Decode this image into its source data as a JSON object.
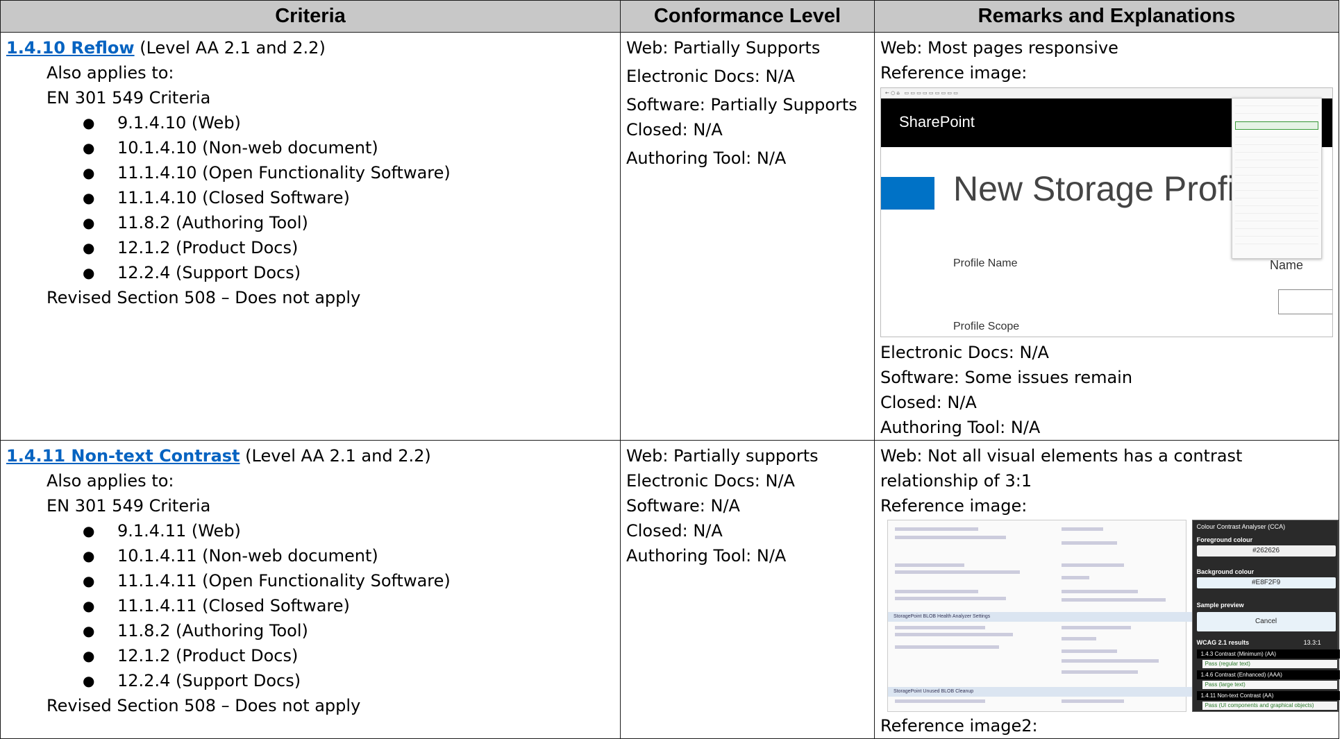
{
  "table": {
    "headers": [
      "Criteria",
      "Conformance Level",
      "Remarks and Explanations"
    ],
    "rows": [
      {
        "criterion_link": "1.4.10 Reflow",
        "criterion_level": " (Level AA 2.1 and 2.2)",
        "also_applies": "Also applies to:",
        "en_label": "EN 301 549 Criteria",
        "en_items": [
          "9.1.4.10 (Web)",
          "10.1.4.10 (Non-web document)",
          "11.1.4.10 (Open Functionality Software)",
          "11.1.4.10 (Closed Software)",
          "11.8.2 (Authoring Tool)",
          "12.1.2 (Product Docs)",
          "12.2.4 (Support Docs)"
        ],
        "section508": "Revised Section 508 – Does not apply",
        "conformance": [
          "Web: Partially Supports",
          "Electronic Docs: N/A",
          "Software: Partially Supports",
          "Closed: N/A",
          "Authoring Tool: N/A"
        ],
        "remarks_top": [
          "Web: Most pages responsive",
          "Reference image:"
        ],
        "image": {
          "brand": "SharePoint",
          "title": "New Storage Profile",
          "field1": "Profile Name",
          "field2": "Profile Scope",
          "field3": "Name"
        },
        "remarks_bottom": [
          "Electronic Docs: N/A",
          "Software: Some issues remain",
          "Closed: N/A",
          "Authoring Tool: N/A"
        ]
      },
      {
        "criterion_link": "1.4.11 Non-text Contrast",
        "criterion_level": " (Level AA 2.1 and 2.2)",
        "also_applies": "Also applies to:",
        "en_label": "EN 301 549 Criteria",
        "en_items": [
          "9.1.4.11 (Web)",
          "10.1.4.11 (Non-web document)",
          "11.1.4.11 (Open Functionality Software)",
          "11.1.4.11 (Closed Software)",
          "11.8.2 (Authoring Tool)",
          "12.1.2 (Product Docs)",
          "12.2.4 (Support Docs)"
        ],
        "section508": "Revised Section 508 – Does not apply",
        "conformance": [
          "Web: Partially supports",
          "Electronic Docs: N/A",
          "Software: N/A",
          "Closed: N/A",
          "Authoring Tool: N/A"
        ],
        "remarks_top": [
          "Web: Not all visual elements has a contrast",
          "relationship of 3:1",
          "Reference image:"
        ],
        "image": {
          "cca_title": "Colour Contrast Analyser (CCA)",
          "fg_label": "Foreground colour",
          "fg_value": "#262626",
          "bg_label": "Background colour",
          "bg_value": "#E8F2F9",
          "preview_label": "Sample preview",
          "cancel": "Cancel",
          "results_label": "WCAG 2.1 results",
          "ratio": "13.3:1",
          "crit1": "1.4.3 Contrast (Minimum) (AA)",
          "crit2": "1.4.6 Contrast (Enhanced) (AAA)",
          "crit3": "1.4.11 Non-text Contrast (AA)",
          "pass_regular": "Pass (regular text)",
          "pass_large": "Pass (large text)",
          "pass_ui": "Pass (UI components and graphical objects)",
          "settings_heading": "StoragePoint BLOB Health Analyzer Settings",
          "settings_heading2": "StoragePoint Unused BLOB Cleanup"
        },
        "remarks_bottom": [
          "Reference image2:"
        ]
      }
    ]
  },
  "colors": {
    "link": "#0563c1",
    "header_bg": "#c8c8c8",
    "sharepoint_blue": "#0072c6"
  }
}
